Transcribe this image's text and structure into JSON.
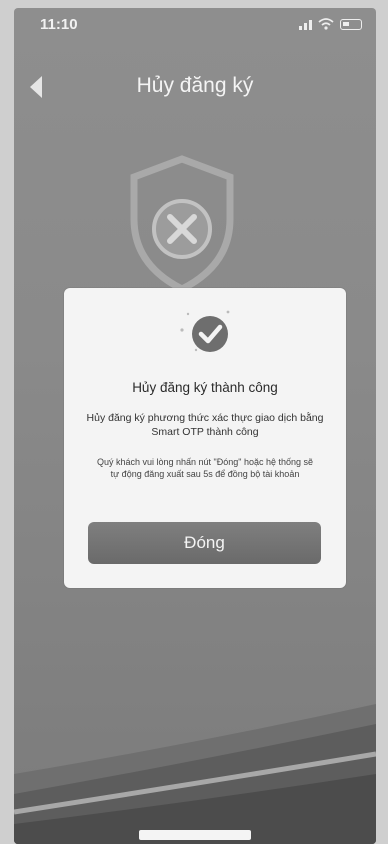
{
  "status_bar": {
    "time": "11:10"
  },
  "nav": {
    "title": "Hủy đăng ký"
  },
  "dialog": {
    "title": "Hủy đăng ký thành công",
    "message": "Hủy đăng ký phương thức xác thực giao dịch bằng Smart OTP thành công",
    "note": "Quý khách vui lòng nhấn nút \"Đóng\" hoặc hệ thống sẽ tự động đăng xuất sau 5s để đồng bộ tài khoản",
    "close_label": "Đóng"
  },
  "icons": {
    "back": "back-arrow-icon",
    "shield": "shield-x-icon",
    "check": "check-circle-icon"
  }
}
